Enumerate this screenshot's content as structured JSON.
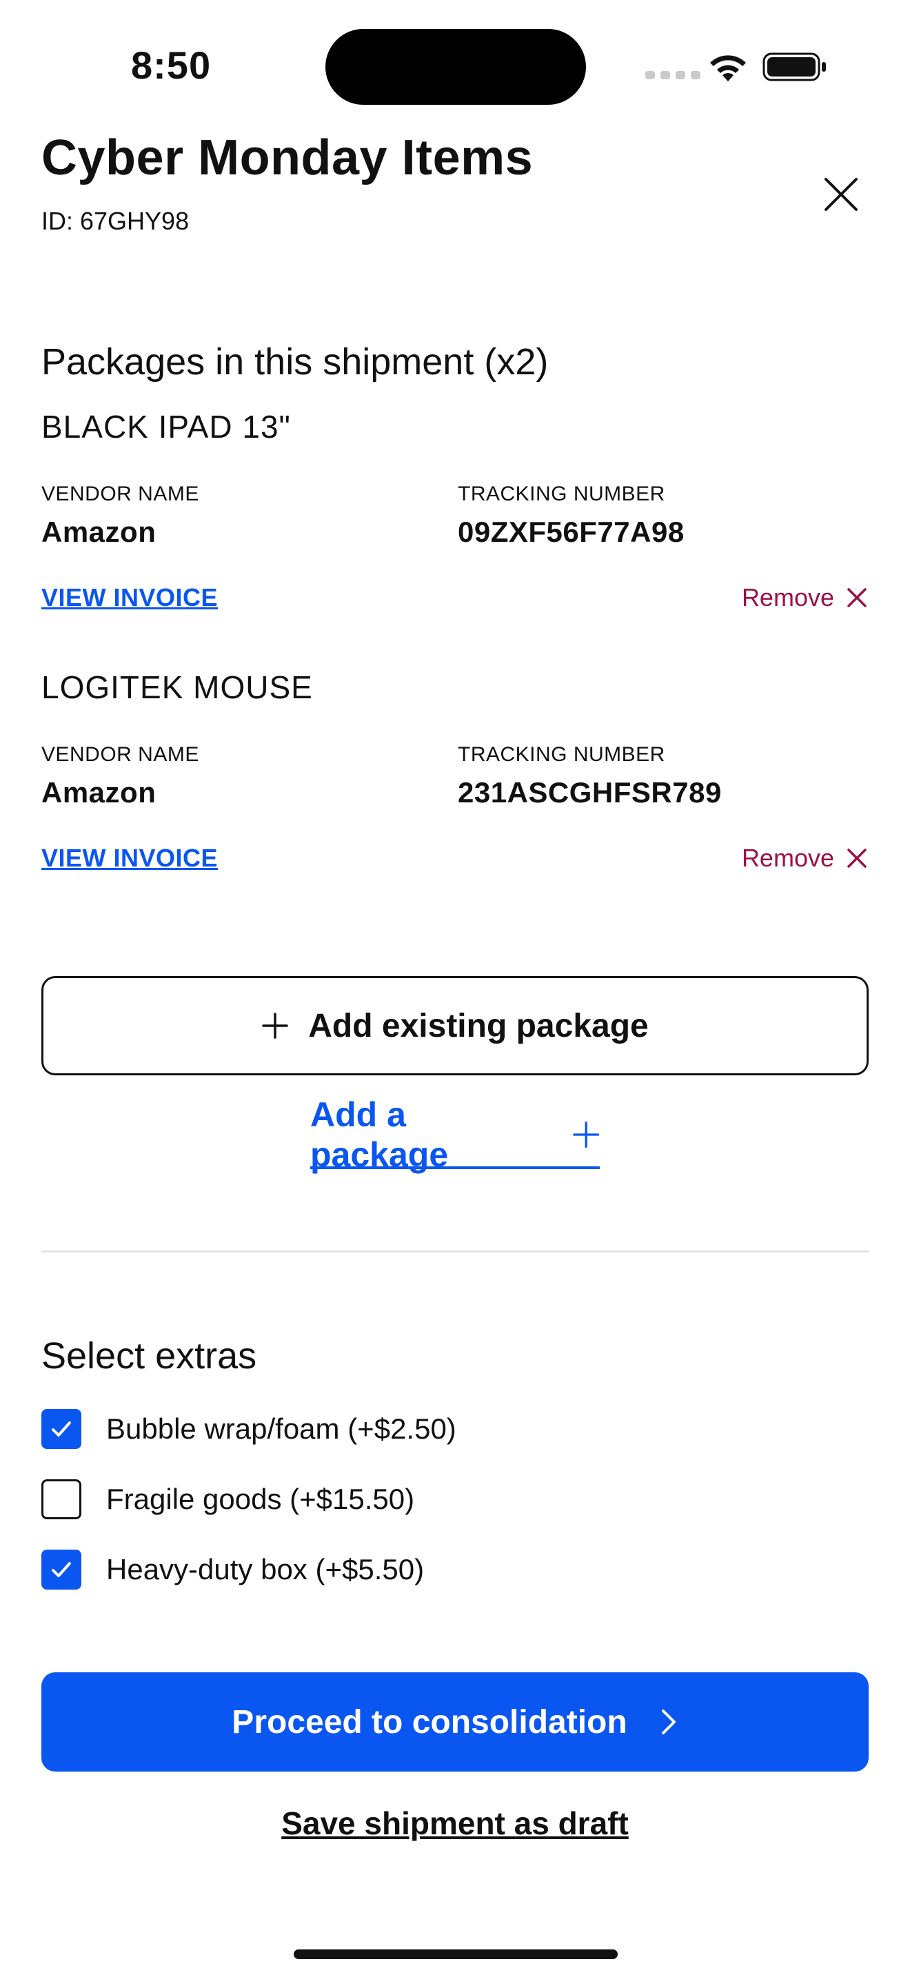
{
  "status_bar": {
    "time": "8:50"
  },
  "header": {
    "title": "Cyber Monday Items",
    "id_text": "ID: 67GHY98"
  },
  "packages_section": {
    "title": "Packages in this shipment (x2)",
    "vendor_label": "VENDOR NAME",
    "tracking_label": "TRACKING NUMBER",
    "invoice_label": "VIEW INVOICE",
    "remove_label": "Remove",
    "items": [
      {
        "name": "BLACK IPAD 13\"",
        "vendor": "Amazon",
        "tracking": "09ZXF56F77A98"
      },
      {
        "name": "LOGITEK MOUSE",
        "vendor": "Amazon",
        "tracking": "231ASCGHFSR789"
      }
    ]
  },
  "actions": {
    "add_existing_label": "Add existing package",
    "add_package_label": "Add a package"
  },
  "extras": {
    "title": "Select extras",
    "options": [
      {
        "label": "Bubble wrap/foam (+$2.50)",
        "checked": true
      },
      {
        "label": "Fragile goods (+$15.50)",
        "checked": false
      },
      {
        "label": "Heavy-duty box (+$5.50)",
        "checked": true
      }
    ]
  },
  "footer": {
    "proceed_label": "Proceed to consolidation",
    "draft_label": "Save shipment as draft"
  },
  "colors": {
    "accent": "#0a56f0",
    "remove": "#9b1147",
    "text": "#111111"
  }
}
